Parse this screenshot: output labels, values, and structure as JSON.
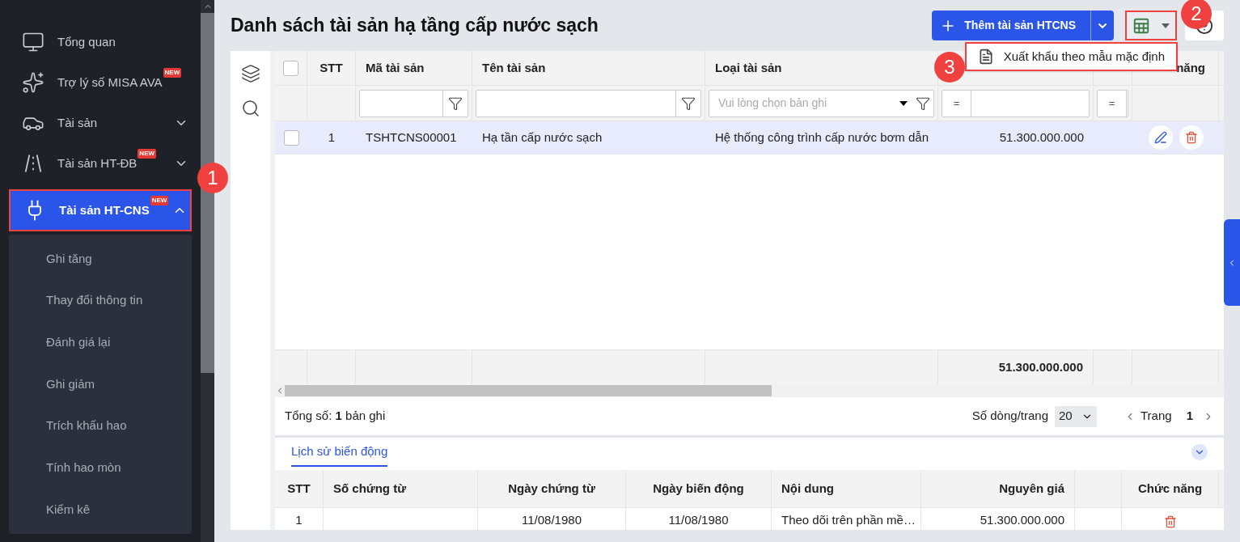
{
  "sidebar": {
    "items": [
      {
        "label": "Tổng quan",
        "selected": false
      },
      {
        "label": "Trợ lý số MISA AVA",
        "badge": "NEW",
        "selected": false
      },
      {
        "label": "Tài sản",
        "expanded": false,
        "selected": false
      },
      {
        "label": "Tài sản HT-ĐB",
        "badge": "NEW",
        "expanded": false,
        "selected": false
      },
      {
        "label": "Tài sản HT-CNS",
        "badge": "NEW",
        "expanded": true,
        "selected": true,
        "children": [
          {
            "label": "Ghi tăng"
          },
          {
            "label": "Thay đổi thông tin"
          },
          {
            "label": "Đánh giá lại"
          },
          {
            "label": "Ghi giảm"
          },
          {
            "label": "Trích khấu hao"
          },
          {
            "label": "Tính hao mòn"
          },
          {
            "label": "Kiểm kê"
          }
        ]
      }
    ]
  },
  "header": {
    "title": "Danh sách tài sản hạ tầng cấp nước sạch",
    "add_button": "Thêm tài sản HTCNS",
    "export_menu": {
      "items": [
        "Xuất khẩu theo mẫu mặc định"
      ]
    }
  },
  "annotations": [
    "1",
    "2",
    "3"
  ],
  "table": {
    "select_all": {
      "checked": false
    },
    "columns": [
      {
        "label": "STT"
      },
      {
        "label": "Mã tài sản",
        "kind": "text"
      },
      {
        "label": "Tên tài sản",
        "kind": "text"
      },
      {
        "label": "Loại tài sản",
        "kind": "select",
        "placeholder": "Vui lòng chọn bản ghi"
      },
      {
        "kind": "compare",
        "operator": "="
      },
      {
        "kind": "compare",
        "operator": "="
      },
      {
        "label": "năng"
      }
    ],
    "rows": [
      {
        "checked": false,
        "selected": true,
        "stt": "1",
        "asset_code": "TSHTCNS00001",
        "asset_name": "Hạ tần cấp nước sạch",
        "asset_type": "Hệ thống công trình cấp nước bơm dẫn",
        "original_cost": "51.300.000.000"
      }
    ],
    "total": "51.300.000.000"
  },
  "pagination": {
    "summary": "Tổng số: **1** bản ghi",
    "page_size_label": "Số dòng/trang",
    "page_size": "20",
    "page_label": "Trang",
    "page": "1"
  },
  "history": {
    "tabs": [
      {
        "label": "Lịch sử biến động",
        "selected": true
      }
    ],
    "columns": [
      {
        "label": "STT"
      },
      {
        "label": "Số chứng từ"
      },
      {
        "label": "Ngày chứng từ"
      },
      {
        "label": "Ngày biến động"
      },
      {
        "label": "Nội dung"
      },
      {
        "label": "Nguyên giá"
      },
      {},
      {
        "label": "Chức năng"
      }
    ],
    "rows": [
      {
        "stt": "1",
        "voucher_date": "11/08/1980",
        "change_date": "11/08/1980",
        "description": "Theo dõi trên phần mề…",
        "original_cost": "51.300.000.000"
      }
    ]
  }
}
